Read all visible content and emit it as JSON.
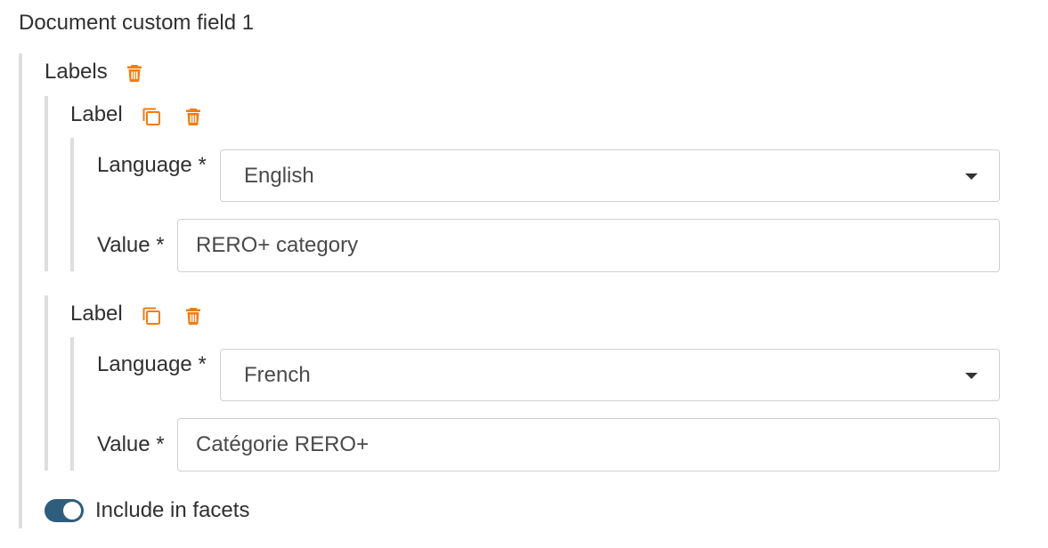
{
  "section": {
    "title": "Document custom field 1"
  },
  "labels": {
    "heading": "Labels",
    "delete_icon": "trash-icon"
  },
  "entries": [
    {
      "heading": "Label",
      "copy_icon": "copy-icon",
      "delete_icon": "trash-icon",
      "language_label": "Language *",
      "language_value": "English",
      "value_label": "Value *",
      "value_value": "RERO+ category"
    },
    {
      "heading": "Label",
      "copy_icon": "copy-icon",
      "delete_icon": "trash-icon",
      "language_label": "Language *",
      "language_value": "French",
      "value_label": "Value *",
      "value_value": "Catégorie RERO+"
    }
  ],
  "facets": {
    "label": "Include in facets",
    "enabled": true
  },
  "colors": {
    "accent_orange": "#f07d11",
    "toggle_blue": "#2f5d7e",
    "indent_bar": "#dedede"
  }
}
